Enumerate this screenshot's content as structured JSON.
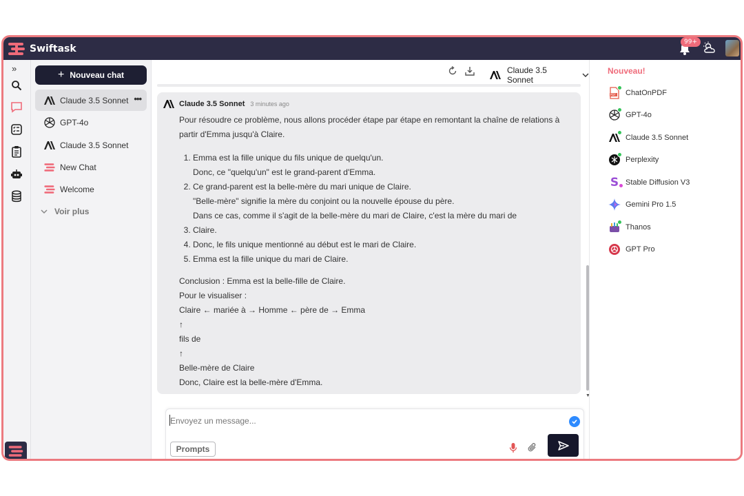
{
  "app": {
    "name": "Swiftask",
    "notifications_badge": "99+",
    "accent": "#ef6b7a",
    "dark": "#2d2c45"
  },
  "rail": {
    "icons": [
      "expand-icon",
      "search-icon",
      "chat-icon",
      "tasks-icon",
      "clipboard-icon",
      "bot-icon",
      "database-icon"
    ]
  },
  "history": {
    "new_chat_label": "Nouveau chat",
    "items": [
      {
        "label": "Claude 3.5 Sonnet",
        "icon": "anthropic-icon",
        "active": true
      },
      {
        "label": "GPT-4o",
        "icon": "openai-icon"
      },
      {
        "label": "Claude 3.5 Sonnet",
        "icon": "anthropic-icon"
      },
      {
        "label": "New Chat",
        "icon": "swiftask-icon"
      },
      {
        "label": "Welcome",
        "icon": "swiftask-icon"
      }
    ],
    "more_label": "Voir plus"
  },
  "toolbar": {
    "model": "Claude 3.5 Sonnet"
  },
  "message": {
    "author": "Claude 3.5 Sonnet",
    "time": "3 minutes ago",
    "intro": "Pour résoudre ce problème, nous allons procéder étape par étape en remontant la chaîne de relations à partir d'Emma jusqu'à Claire.",
    "steps": [
      {
        "main": "Emma est la fille unique du fils unique de quelqu'un.",
        "sub": "Donc, ce \"quelqu'un\" est le grand-parent d'Emma."
      },
      {
        "main": "Ce grand-parent est la belle-mère du mari unique de Claire.",
        "sub": "\"Belle-mère\" signifie la mère du conjoint ou la nouvelle épouse du père."
      },
      {
        "main": "Dans ce cas, comme il s'agit de la belle-mère du mari de Claire, c'est la mère du mari de Claire.",
        "sub": ""
      },
      {
        "main": "Donc, le fils unique mentionné au début est le mari de Claire.",
        "sub": ""
      },
      {
        "main": "Emma est la fille unique du mari de Claire.",
        "sub": ""
      }
    ],
    "conclusion": [
      "Conclusion : Emma est la belle-fille de Claire.",
      "Pour le visualiser :",
      "Claire ← mariée à → Homme ← père de → Emma",
      "↑",
      "fils de",
      "↑",
      "Belle-mère de Claire",
      "Donc, Claire est la belle-mère d'Emma."
    ]
  },
  "composer": {
    "placeholder": "Envoyez un message...",
    "prompts_label": "Prompts"
  },
  "models_panel": {
    "heading": "Nouveau!",
    "items": [
      {
        "label": "ChatOnPDF",
        "icon": "pdf-icon"
      },
      {
        "label": "GPT-4o",
        "icon": "openai-icon"
      },
      {
        "label": "Claude 3.5 Sonnet",
        "icon": "anthropic-icon"
      },
      {
        "label": "Perplexity",
        "icon": "perplexity-icon"
      },
      {
        "label": "Stable Diffusion V3",
        "icon": "stable-diffusion-icon"
      },
      {
        "label": "Gemini Pro 1.5",
        "icon": "gemini-icon"
      },
      {
        "label": "Thanos",
        "icon": "thanos-icon"
      },
      {
        "label": "GPT Pro",
        "icon": "gpt-pro-icon"
      }
    ]
  }
}
